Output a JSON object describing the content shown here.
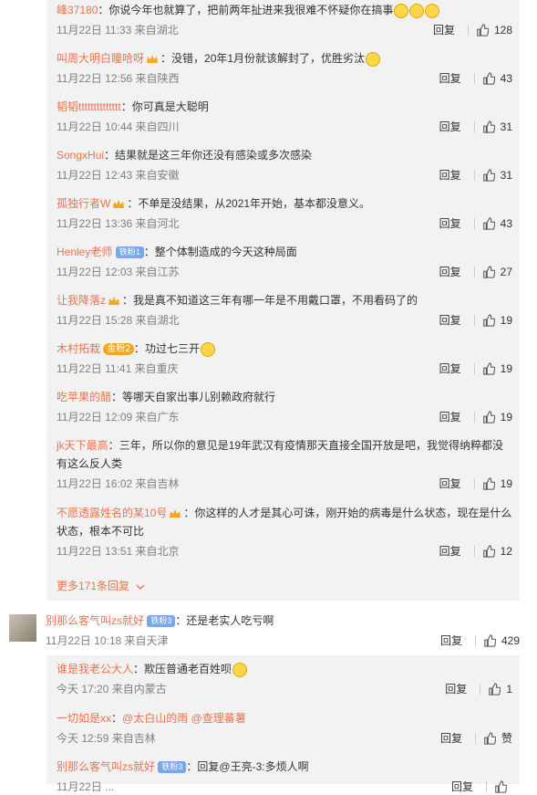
{
  "subcomments": [
    {
      "user": "峰37180",
      "sep": "：",
      "text": "你说今年也就算了，把前两年扯进来我很难不怀疑你在搞事",
      "time": "11月22日 11:33 来自湖北",
      "reply": "回复",
      "likes": "128"
    },
    {
      "user": "叫周大明白瞳哈呀",
      "sep": "：",
      "text": "没错，20年1月份就该解封了，优胜劣汰",
      "time": "11月22日 12:56 来自陕西",
      "reply": "回复",
      "likes": "43"
    },
    {
      "user": "韬韬tttttttttttttt",
      "sep": "：",
      "text": "你可真是大聪明",
      "time": "11月22日 10:44 来自四川",
      "reply": "回复",
      "likes": "31"
    },
    {
      "user": "SongxHui",
      "sep": "：",
      "text": "结果就是这三年你还没有感染或多次感染",
      "time": "11月22日 12:43 来自安徽",
      "reply": "回复",
      "likes": "31"
    },
    {
      "user": "孤独行者W",
      "sep": "：",
      "text": "不单是没结果，从2021年开始，基本都没意义。",
      "time": "11月22日 13:36 来自河北",
      "reply": "回复",
      "likes": "43"
    },
    {
      "user": "Henley老师",
      "badge": "铁粉1",
      "sep": "：",
      "text": "整个体制造成的今天这种局面",
      "time": "11月22日 12:03 来自江苏",
      "reply": "回复",
      "likes": "27"
    },
    {
      "user": "让我降落z",
      "sep": "：",
      "text": "我是真不知道这三年有哪一年是不用戴口罩，不用看码了的",
      "time": "11月22日 15:28 来自湖北",
      "reply": "回复",
      "likes": "19"
    },
    {
      "user": "木村拓栽",
      "badge": "金粉2",
      "sep": "：",
      "text": "功过七三开",
      "time": "11月22日 11:41 来自重庆",
      "reply": "回复",
      "likes": "19"
    },
    {
      "user": "吃苹果的醋",
      "sep": "：",
      "text": "等哪天自家出事儿别赖政府就行",
      "time": "11月22日 12:09 来自广东",
      "reply": "回复",
      "likes": "19"
    },
    {
      "user": "jk天下最高",
      "sep": "：",
      "text": "三年，所以你的意见是19年武汉有疫情那天直接全国开放是吧，我觉得纳粹都没有这么反人类",
      "time": "11月22日 16:02 来自吉林",
      "reply": "回复",
      "likes": "19"
    },
    {
      "user": "不愿透露姓名的某10号",
      "sep": "：",
      "text": "你这样的人才是其心可诛，刚开始的病毒是什么状态，现在是什么状态，根本不可比",
      "time": "11月22日 13:51 来自北京",
      "reply": "回复",
      "likes": "12"
    }
  ],
  "more_label": "更多171条回复",
  "top": {
    "user": "别那么客气叫zs就好",
    "badge": "铁粉3",
    "sep": "：",
    "text": "还是老实人吃亏啊",
    "time": "11月22日 10:18 来自天津",
    "reply": "回复",
    "likes": "429"
  },
  "replies": [
    {
      "user": "谁是我老公大人",
      "sep": "：",
      "text": "欺压普通老百姓呗",
      "time": "今天 17:20 来自内蒙古",
      "reply": "回复",
      "likes": "1"
    },
    {
      "user": "一切如是xx",
      "sep": "：",
      "text": "@太白山的雨 @查理蕃薯",
      "time": "今天 12:59 来自吉林",
      "reply": "回复",
      "likes": "赞"
    },
    {
      "user": "别那么客气叫zs就好",
      "badge": "铁粉3",
      "sep": "：",
      "text": "回复@王亮-3:多烦人啊",
      "time": "11月22日 ...",
      "reply": "回复",
      "likes": ""
    }
  ]
}
